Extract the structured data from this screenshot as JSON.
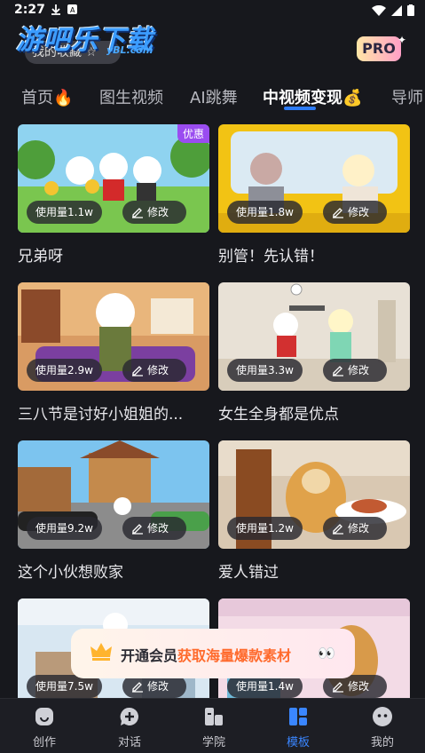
{
  "status_bar": {
    "time": "2:27"
  },
  "header": {
    "logo_text": "游吧乐下载",
    "logo_sub": "yBL.com",
    "favorites_label": "我的收藏",
    "pro_label": "PRO"
  },
  "tabs": [
    {
      "label": "首页🔥"
    },
    {
      "label": "图生视频"
    },
    {
      "label": "AI跳舞"
    },
    {
      "label": "中视频变现💰"
    },
    {
      "label": "导师"
    }
  ],
  "cards": [
    {
      "title": "兄弟呀",
      "usage": "使用量1.1w",
      "edit": "修改",
      "badge": "优惠"
    },
    {
      "title": "别管！先认错！",
      "usage": "使用量1.8w",
      "edit": "修改",
      "badge": ""
    },
    {
      "title": "三八节是讨好小姐姐的...",
      "usage": "使用量2.9w",
      "edit": "修改",
      "badge": ""
    },
    {
      "title": "女生全身都是优点",
      "usage": "使用量3.3w",
      "edit": "修改",
      "badge": ""
    },
    {
      "title": "这个小伙想败家",
      "usage": "使用量9.2w",
      "edit": "修改",
      "badge": ""
    },
    {
      "title": "爱人错过",
      "usage": "使用量1.2w",
      "edit": "修改",
      "badge": ""
    },
    {
      "title": "",
      "usage": "使用量7.5w",
      "edit": "修改",
      "badge": ""
    },
    {
      "title": "",
      "usage": "使用量1.4w",
      "edit": "修改",
      "badge": ""
    }
  ],
  "banner": {
    "prefix": "开通会员",
    "highlight": "获取海量爆款素材",
    "suffix": "👀"
  },
  "bottom_nav": [
    {
      "label": "创作",
      "icon": "create-icon"
    },
    {
      "label": "对话",
      "icon": "chat-icon"
    },
    {
      "label": "学院",
      "icon": "academy-icon"
    },
    {
      "label": "模板",
      "icon": "template-icon"
    },
    {
      "label": "我的",
      "icon": "profile-icon"
    }
  ],
  "colors": {
    "accent": "#3a86ff",
    "highlight": "#ff6a2c",
    "promo": "#9a4cf0"
  }
}
